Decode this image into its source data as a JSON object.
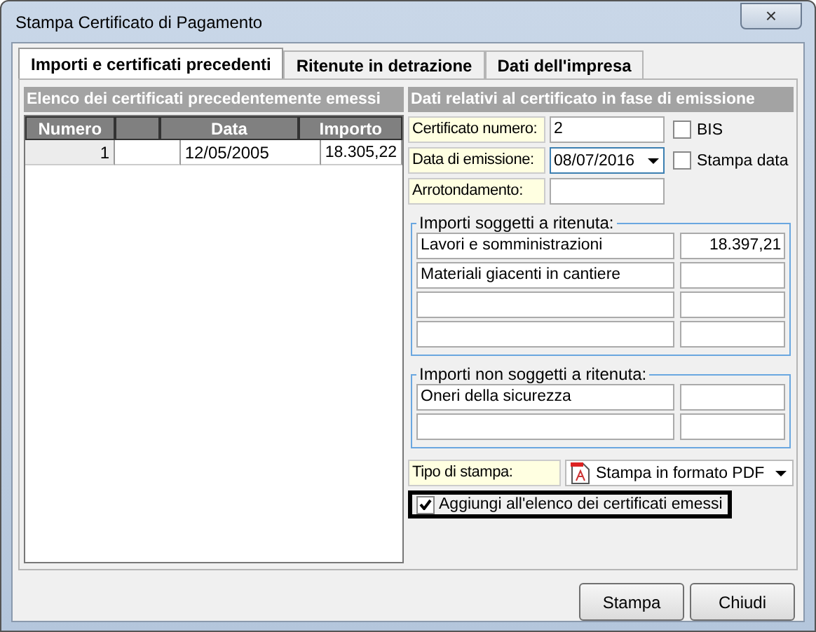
{
  "window": {
    "title": "Stampa Certificato di Pagamento",
    "close": "×"
  },
  "tabs": [
    {
      "label": "Importi e certificati precedenti",
      "selected": true
    },
    {
      "label": "Ritenute in detrazione",
      "selected": false
    },
    {
      "label": "Dati dell'impresa",
      "selected": false
    }
  ],
  "previous_certificates": {
    "heading": "Elenco dei certificati precedentemente emessi",
    "columns": [
      "Numero",
      null,
      "Data",
      "Importo"
    ],
    "rows": [
      {
        "cells": [
          "1",
          null,
          "12/05/2005",
          "18.305,22"
        ]
      }
    ]
  },
  "current_certificate": {
    "heading": "Dati relativi al certificato in fase di emissione",
    "fields": [
      {
        "label": "Certificato numero:",
        "value": "2",
        "kind": "text",
        "option": {
          "label": "BIS",
          "checked": false
        }
      },
      {
        "label": "Data di emissione:",
        "value": "08/07/2016",
        "kind": "dropdown",
        "option": {
          "label": "Stampa data",
          "checked": false
        }
      },
      {
        "label": "Arrotondamento:",
        "kind": "text"
      }
    ]
  },
  "groups": [
    {
      "title": "Importi soggetti a ritenuta:",
      "rows": [
        {
          "name": "Lavori e somministrazioni",
          "amount": "18.397,21"
        },
        {
          "name": "Materiali giacenti in cantiere"
        },
        {},
        {}
      ]
    },
    {
      "title": "Importi non soggetti a ritenuta:",
      "rows": [
        {
          "name": "Oneri della sicurezza"
        },
        {}
      ]
    }
  ],
  "print_type": {
    "label": "Tipo di stampa:",
    "value": "Stampa in formato PDF"
  },
  "add_to_list": {
    "label": "Aggiungi all'elenco dei certificati emessi",
    "checked": true,
    "focused": true
  },
  "buttons": [
    "Stampa",
    "Chiudi"
  ]
}
